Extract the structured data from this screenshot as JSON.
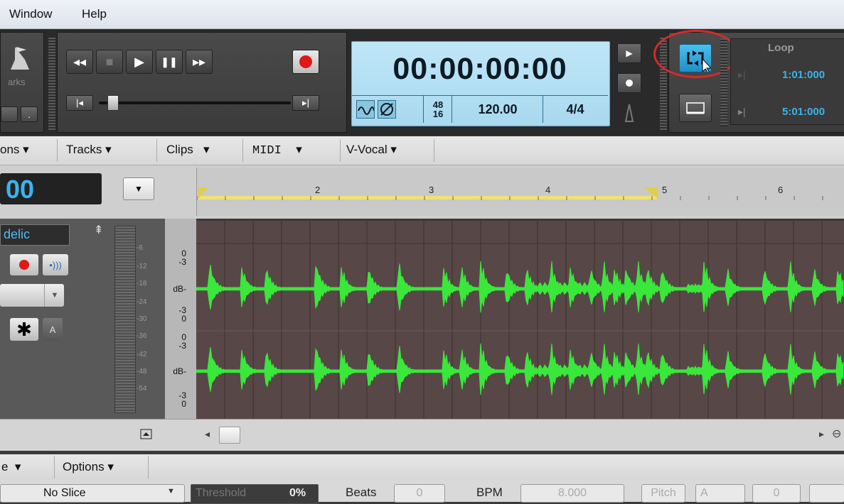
{
  "menu": {
    "window": "Window",
    "help": "Help"
  },
  "markers": {
    "label": "arks",
    "dot_btn": "."
  },
  "transport": {
    "rewind": "◂◂",
    "stop": "■",
    "play": "▶",
    "pause": "❚❚",
    "ffwd": "▸▸",
    "start": "|◂",
    "end": "▸|"
  },
  "now_time": {
    "time": "00:00:00:00",
    "fraction_top": "48",
    "fraction_bottom": "16",
    "tempo": "120.00",
    "meter": "4/4"
  },
  "loop": {
    "title": "Loop",
    "start": "1:01:000",
    "end": "5:01:000"
  },
  "tabs": {
    "options_partial": "ons",
    "tracks": "Tracks",
    "clips": "Clips",
    "midi": "MIDI",
    "vvocal": "V-Vocal"
  },
  "time_display": "00",
  "ruler": {
    "ticks": [
      "2",
      "3",
      "4",
      "5",
      "6"
    ]
  },
  "track": {
    "name": "delic",
    "star_btn": "✱",
    "a_btn": "A"
  },
  "db_scale": {
    "top": [
      "0",
      "-3",
      "dB-",
      "-3",
      "0"
    ],
    "bottom": [
      "0",
      "-3",
      "dB-",
      "-3",
      "0"
    ]
  },
  "meter_labels": [
    "-6",
    "-12",
    "-18",
    "-24",
    "-30",
    "-36",
    "-42",
    "-48",
    "-54"
  ],
  "bottom_tabs": {
    "left_partial": "e",
    "options": "Options"
  },
  "slice": {
    "mode": "No Slice",
    "threshold_label": "Threshold",
    "threshold_value": "0%",
    "beats_label": "Beats",
    "beats_value": "0",
    "bpm_label": "BPM",
    "bpm_value": "8.000",
    "pitch_label": "Pitch",
    "pitch_value": "A",
    "extra_value": "0"
  },
  "colors": {
    "waveform": "#39e83a",
    "lcd": "#b2def2",
    "loop_highlight": "#d62a2a",
    "time_accent": "#3ab4ef"
  }
}
